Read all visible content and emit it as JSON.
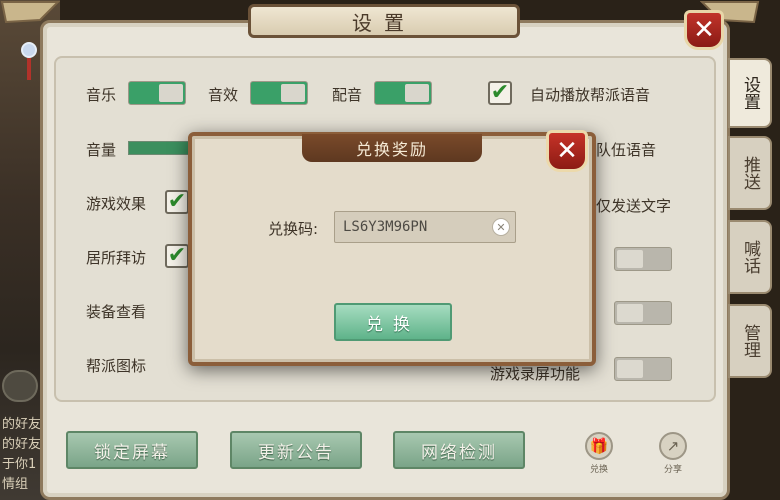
{
  "settings_dialog": {
    "title": "设置",
    "close_label": "✕",
    "tabs": [
      {
        "label": "设置"
      },
      {
        "label": "推送"
      },
      {
        "label": "喊话"
      },
      {
        "label": "管理"
      }
    ],
    "music_label": "音乐",
    "sound_label": "音效",
    "voice_label": "配音",
    "autoplay_guild_voice_label": "自动播放帮派语音",
    "autoplay_team_voice_label": "队伍语音",
    "send_text_only_label": "仅发送文字",
    "volume_label": "音量",
    "game_effects_label": "游戏效果",
    "home_visit_label": "居所拜访",
    "equipment_view_label": "装备查看",
    "guild_icon_label": "帮派图标",
    "screen_record_label": "游戏录屏功能",
    "lock_screen_button": "锁定屏幕",
    "update_notice_button": "更新公告",
    "network_check_button": "网络检测",
    "gift_icon_caption": "兑换",
    "share_icon_caption": "分享"
  },
  "background_chat": {
    "lines": [
      "的好友",
      "的好友",
      "于你1",
      "情组"
    ]
  },
  "redeem_modal": {
    "title": "兑换奖励",
    "close_label": "✕",
    "code_label": "兑换码:",
    "code_value": "LS6Y3M96PN",
    "clear_label": "✕",
    "redeem_button": "兑换"
  },
  "colors": {
    "toggle_on": "#3aa068",
    "close_red": "#c1342b",
    "button_green": "#7aa488",
    "modal_border": "#8b5e3a"
  }
}
